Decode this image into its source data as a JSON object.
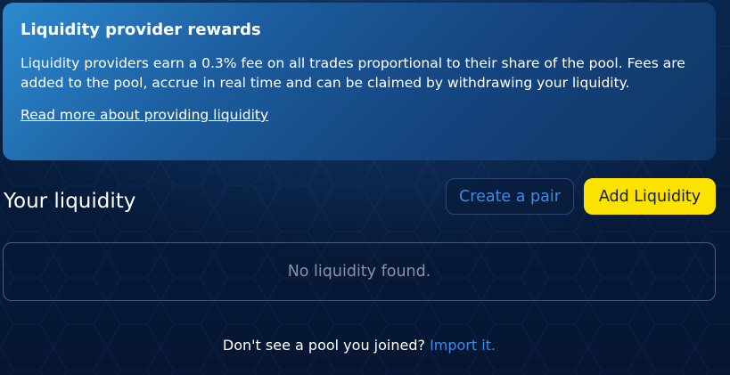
{
  "rewards": {
    "title": "Liquidity provider rewards",
    "line1": "Liquidity providers earn a 0.3% fee on all trades proportional to their share of the pool.",
    "line2": "Fees are added to the pool, accrue in real time and can be claimed by withdrawing your liquidity.",
    "link": "Read more about providing liquidity"
  },
  "liquidity": {
    "title": "Your liquidity",
    "create_pair_label": "Create a pair",
    "add_liquidity_label": "Add Liquidity",
    "empty_message": "No liquidity found."
  },
  "import": {
    "prompt": "Don't see a pool you joined?",
    "link": "Import it."
  },
  "colors": {
    "accent": "#3f8ae6",
    "primary_button": "#fae300",
    "background": "#071b3b"
  }
}
